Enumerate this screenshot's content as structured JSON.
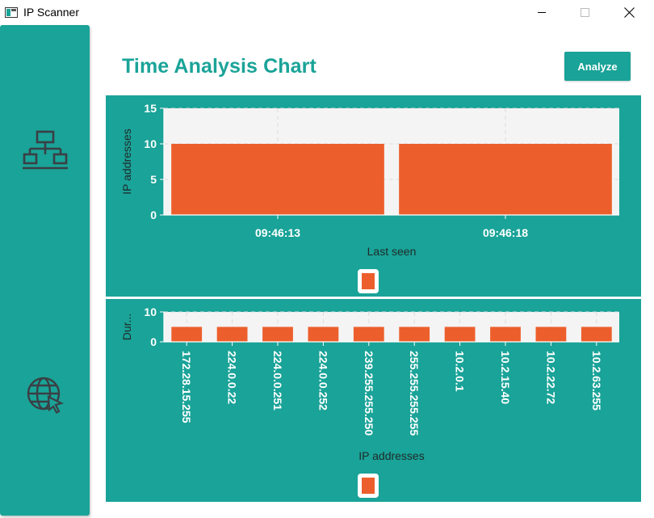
{
  "window": {
    "title": "IP Scanner"
  },
  "sidebar": {
    "items": [
      {
        "icon": "network-topology-icon"
      },
      {
        "icon": "globe-cursor-icon"
      }
    ]
  },
  "header": {
    "title": "Time Analysis Chart",
    "analyze_label": "Analyze"
  },
  "colors": {
    "accent": "#1aa398",
    "bar": "#ec5f2c",
    "plot_bg": "#f4f4f4"
  },
  "chart_data": [
    {
      "type": "bar",
      "categories": [
        "09:46:13",
        "09:46:18"
      ],
      "values": [
        10,
        10
      ],
      "xlabel": "Last seen",
      "ylabel": "IP addresses",
      "ylim": [
        0,
        15
      ],
      "yticks": [
        0,
        5,
        10,
        15
      ],
      "grid": true,
      "legend": "bottom"
    },
    {
      "type": "bar",
      "categories": [
        "172.28.15.255",
        "224.0.0.22",
        "224.0.0.251",
        "224.0.0.252",
        "239.255.255.250",
        "255.255.255.255",
        "10.2.0.1",
        "10.2.15.40",
        "10.2.22.72",
        "10.2.63.255"
      ],
      "values": [
        5,
        5,
        5,
        5,
        5,
        5,
        5,
        5,
        5,
        5
      ],
      "xlabel": "IP addresses",
      "ylabel": "Dur...",
      "ylim": [
        0,
        10
      ],
      "yticks": [
        0,
        10
      ],
      "grid": true,
      "legend": "bottom"
    }
  ]
}
